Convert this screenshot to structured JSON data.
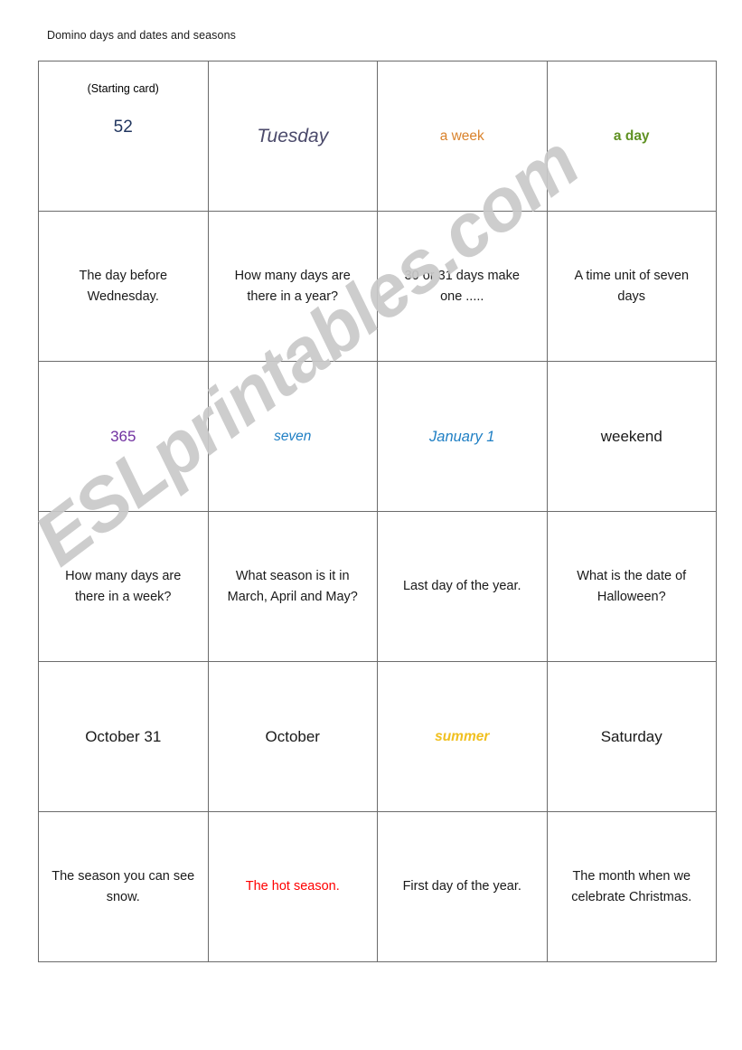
{
  "document": {
    "title": "Domino days and dates and seasons",
    "watermark": "ESLprintables.com"
  },
  "colors": {
    "navy": "#21365f",
    "purple_slate": "#4b4a6b",
    "orange": "#d9822b",
    "green": "#5f9122",
    "violet": "#7030a0",
    "blue": "#1f7fc4",
    "gold": "#f0c020",
    "red": "#ff0000",
    "black": "#1a1a1a",
    "border": "#6b6b6b",
    "watermark": "#c9c9c9"
  },
  "cards": {
    "r1c1": {
      "note": "(Starting card)",
      "text": "52"
    },
    "r1c2": {
      "text": "Tuesday"
    },
    "r1c3": {
      "text": "a week"
    },
    "r1c4": {
      "text": "a day"
    },
    "r2c1": {
      "text": "The day before Wednesday."
    },
    "r2c2": {
      "text": "How many days are there in a year?"
    },
    "r2c3": {
      "text": "30 or 31 days make one ....."
    },
    "r2c4": {
      "text": "A time unit of seven days"
    },
    "r3c1": {
      "text": "365"
    },
    "r3c2": {
      "text": "seven"
    },
    "r3c3": {
      "text": "January 1"
    },
    "r3c4": {
      "text": "weekend"
    },
    "r4c1": {
      "text": "How many days are there in a week?"
    },
    "r4c2": {
      "text": "What season is it in March, April and May?"
    },
    "r4c3": {
      "text": "Last day of the year."
    },
    "r4c4": {
      "text": "What is the date of Halloween?"
    },
    "r5c1": {
      "text": "October 31"
    },
    "r5c2": {
      "text": "October"
    },
    "r5c3": {
      "text": "summer"
    },
    "r5c4": {
      "text": "Saturday"
    },
    "r6c1": {
      "text": "The season you can see snow."
    },
    "r6c2": {
      "text": "The hot season."
    },
    "r6c3": {
      "text": "First day of the year."
    },
    "r6c4": {
      "text": "The month when we celebrate Christmas."
    }
  }
}
